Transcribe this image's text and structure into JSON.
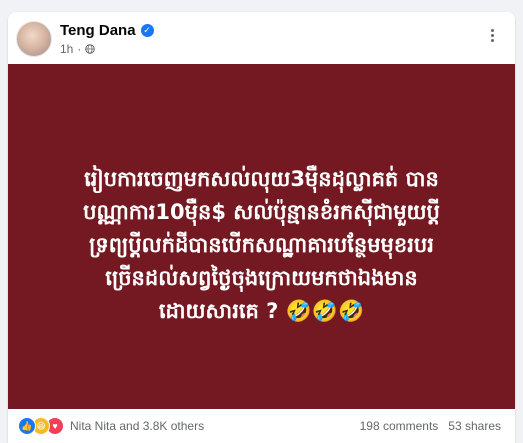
{
  "post": {
    "author": "Teng Dana",
    "time": "1h",
    "text": "រៀបការចេញមកសល់លុយ3ម៉ឺនដុល្លាគត់ បាន\nបណ្ណាការ10ម៉ឺន$ សល់ប៉ុន្មានខំរកស៊ីជាមួយប្តី\nទ្រព្យប្តីលក់ដីបានបើកសណ្ឋាគារបន្ថែមមុខរបរ\nច្រើនដល់សព្វថ្ងៃចុងក្រោយមកថាឯងមាន\nដោយសារគេ ? 🤣🤣🤣",
    "background_color": "#741921"
  },
  "engagement": {
    "reactions_text": "Nita Nita and 3.8K others",
    "comments": "198 comments",
    "shares": "53 shares"
  },
  "colors": {
    "accent": "#1877f2",
    "muted": "#65676b"
  }
}
